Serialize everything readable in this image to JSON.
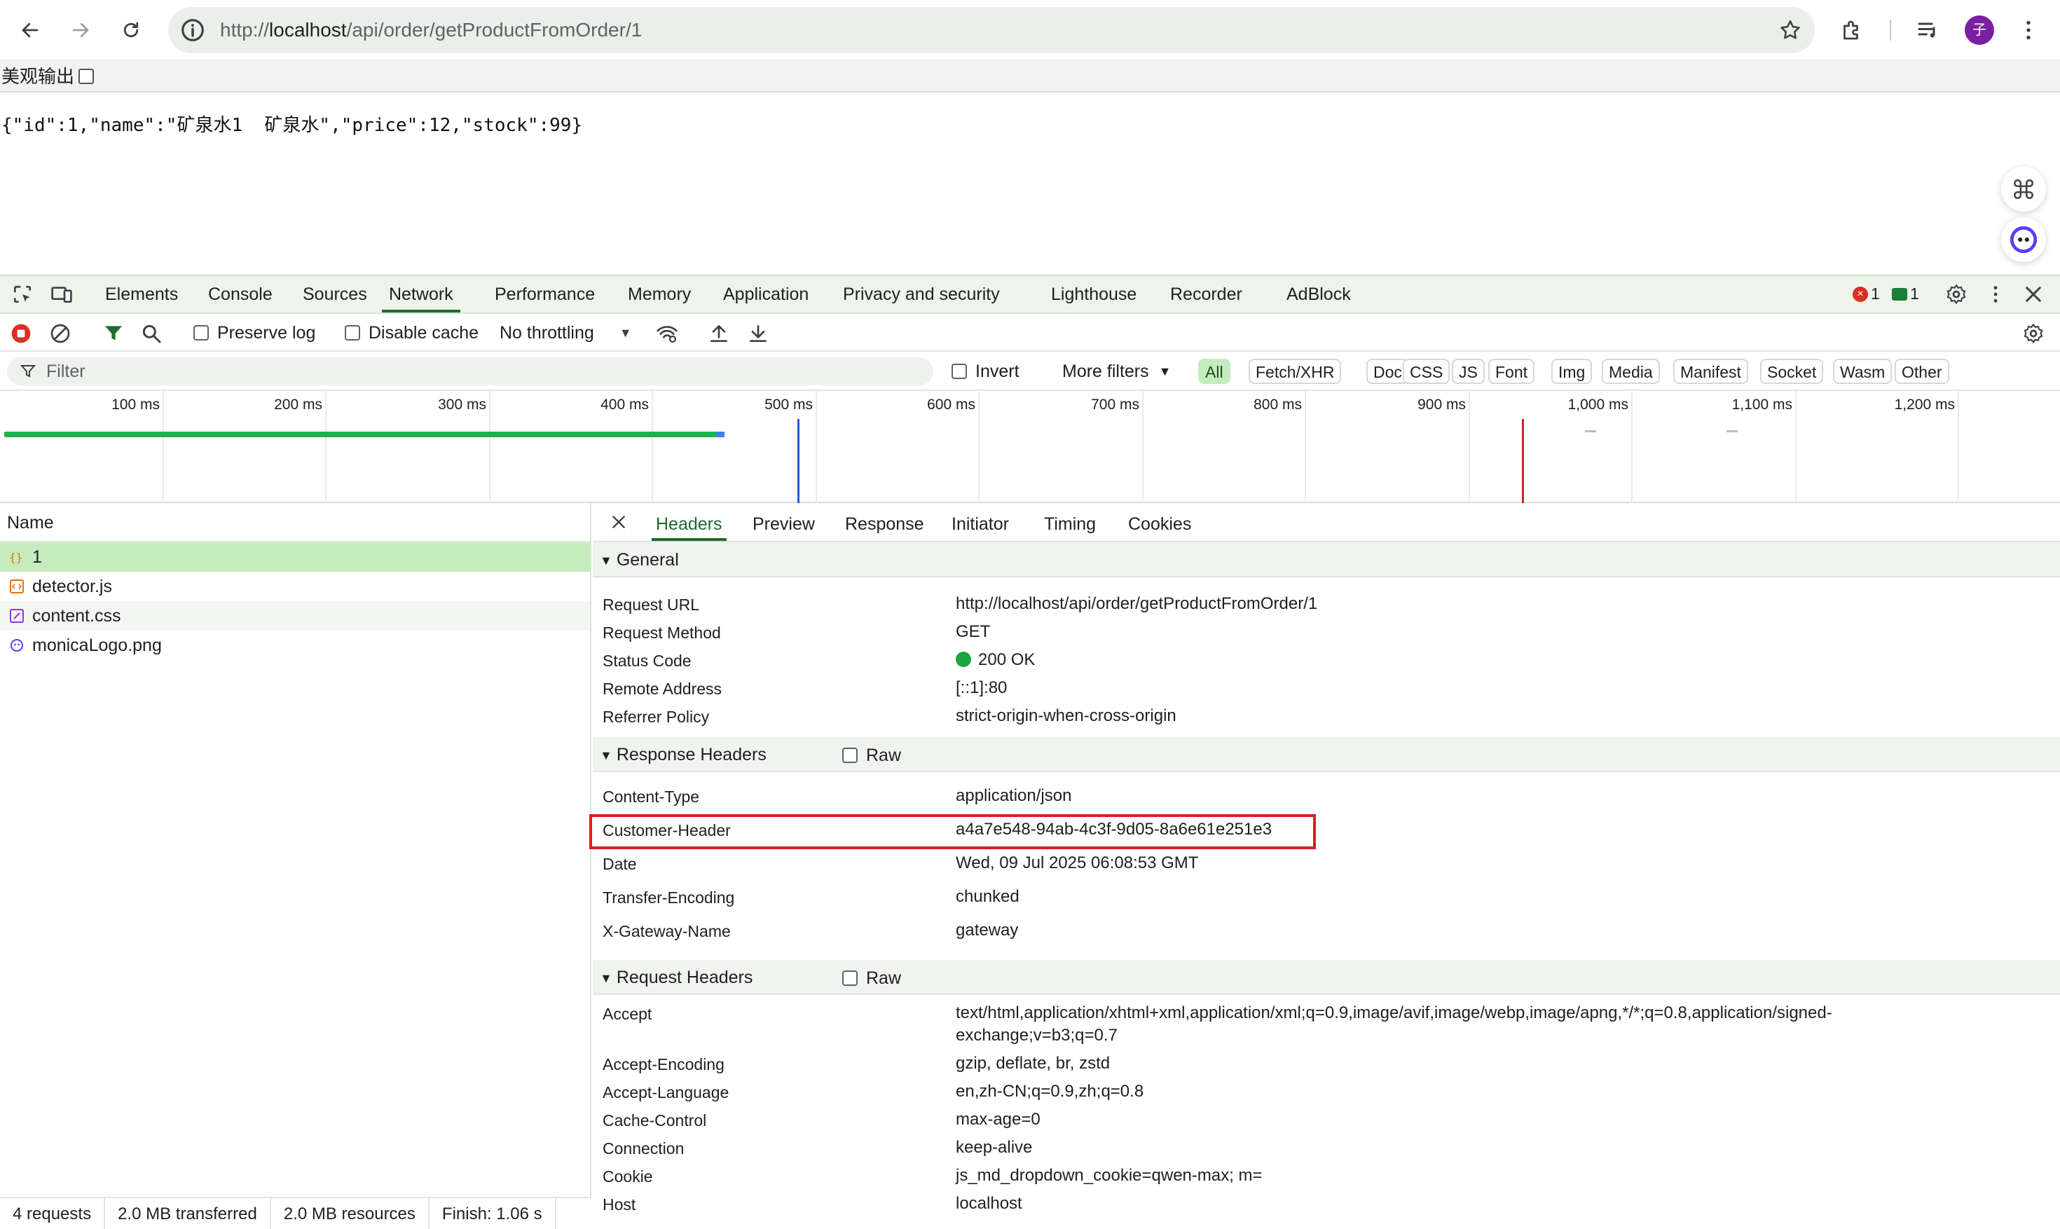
{
  "browser": {
    "url_prefix": "http://",
    "url_host": "localhost",
    "url_path": "/api/order/getProductFromOrder/1",
    "avatar_initial": "子"
  },
  "page": {
    "pretty_print_label": "美观输出",
    "json_text": "{\"id\":1,\"name\":\"矿泉水1  矿泉水\",\"price\":12,\"stock\":99}"
  },
  "devtools": {
    "tabs": [
      "Elements",
      "Console",
      "Sources",
      "Network",
      "Performance",
      "Memory",
      "Application",
      "Privacy and security",
      "Lighthouse",
      "Recorder",
      "AdBlock"
    ],
    "active_tab": "Network",
    "error_count": "1",
    "message_count": "1",
    "toolbar": {
      "preserve_log": "Preserve log",
      "disable_cache": "Disable cache",
      "throttling": "No throttling"
    },
    "filter": {
      "placeholder": "Filter",
      "invert": "Invert",
      "more_filters": "More filters",
      "types": [
        "All",
        "Fetch/XHR",
        "Doc",
        "CSS",
        "JS",
        "Font",
        "Img",
        "Media",
        "Manifest",
        "Socket",
        "Wasm",
        "Other"
      ],
      "active_type": "All"
    },
    "overview_ticks": [
      "100 ms",
      "200 ms",
      "300 ms",
      "400 ms",
      "500 ms",
      "600 ms",
      "700 ms",
      "800 ms",
      "900 ms",
      "1,000 ms",
      "1,100 ms",
      "1,200 ms"
    ],
    "requests": {
      "header": "Name",
      "items": [
        {
          "name": "1",
          "icon": "json-icon"
        },
        {
          "name": "detector.js",
          "icon": "script-icon"
        },
        {
          "name": "content.css",
          "icon": "stylesheet-icon"
        },
        {
          "name": "monicaLogo.png",
          "icon": "image-icon"
        }
      ]
    },
    "status": {
      "requests": "4 requests",
      "transferred": "2.0 MB transferred",
      "resources": "2.0 MB resources",
      "finish": "Finish: 1.06 s"
    },
    "detail_tabs": [
      "Headers",
      "Preview",
      "Response",
      "Initiator",
      "Timing",
      "Cookies"
    ],
    "active_detail_tab": "Headers",
    "general": {
      "title": "General",
      "rows": [
        {
          "k": "Request URL",
          "v": "http://localhost/api/order/getProductFromOrder/1"
        },
        {
          "k": "Request Method",
          "v": "GET"
        },
        {
          "k": "Status Code",
          "v": "200 OK"
        },
        {
          "k": "Remote Address",
          "v": "[::1]:80"
        },
        {
          "k": "Referrer Policy",
          "v": "strict-origin-when-cross-origin"
        }
      ]
    },
    "response_headers": {
      "title": "Response Headers",
      "raw": "Raw",
      "rows": [
        {
          "k": "Content-Type",
          "v": "application/json"
        },
        {
          "k": "Customer-Header",
          "v": "a4a7e548-94ab-4c3f-9d05-8a6e61e251e3"
        },
        {
          "k": "Date",
          "v": "Wed, 09 Jul 2025 06:08:53 GMT"
        },
        {
          "k": "Transfer-Encoding",
          "v": "chunked"
        },
        {
          "k": "X-Gateway-Name",
          "v": "gateway"
        }
      ]
    },
    "request_headers": {
      "title": "Request Headers",
      "raw": "Raw",
      "rows": [
        {
          "k": "Accept",
          "v": "text/html,application/xhtml+xml,application/xml;q=0.9,image/avif,image/webp,image/apng,*/*;q=0.8,application/signed-",
          "v2": "exchange;v=b3;q=0.7"
        },
        {
          "k": "Accept-Encoding",
          "v": "gzip, deflate, br, zstd"
        },
        {
          "k": "Accept-Language",
          "v": "en,zh-CN;q=0.9,zh;q=0.8"
        },
        {
          "k": "Cache-Control",
          "v": "max-age=0"
        },
        {
          "k": "Connection",
          "v": "keep-alive"
        },
        {
          "k": "Cookie",
          "v": "js_md_dropdown_cookie=qwen-max; m="
        },
        {
          "k": "Host",
          "v": "localhost"
        }
      ]
    }
  },
  "colors": {
    "accent_green": "#1e6b2e",
    "selection_green": "#c6ecbe",
    "highlight_red": "#e01b1b",
    "status_ok": "#1fa541"
  }
}
